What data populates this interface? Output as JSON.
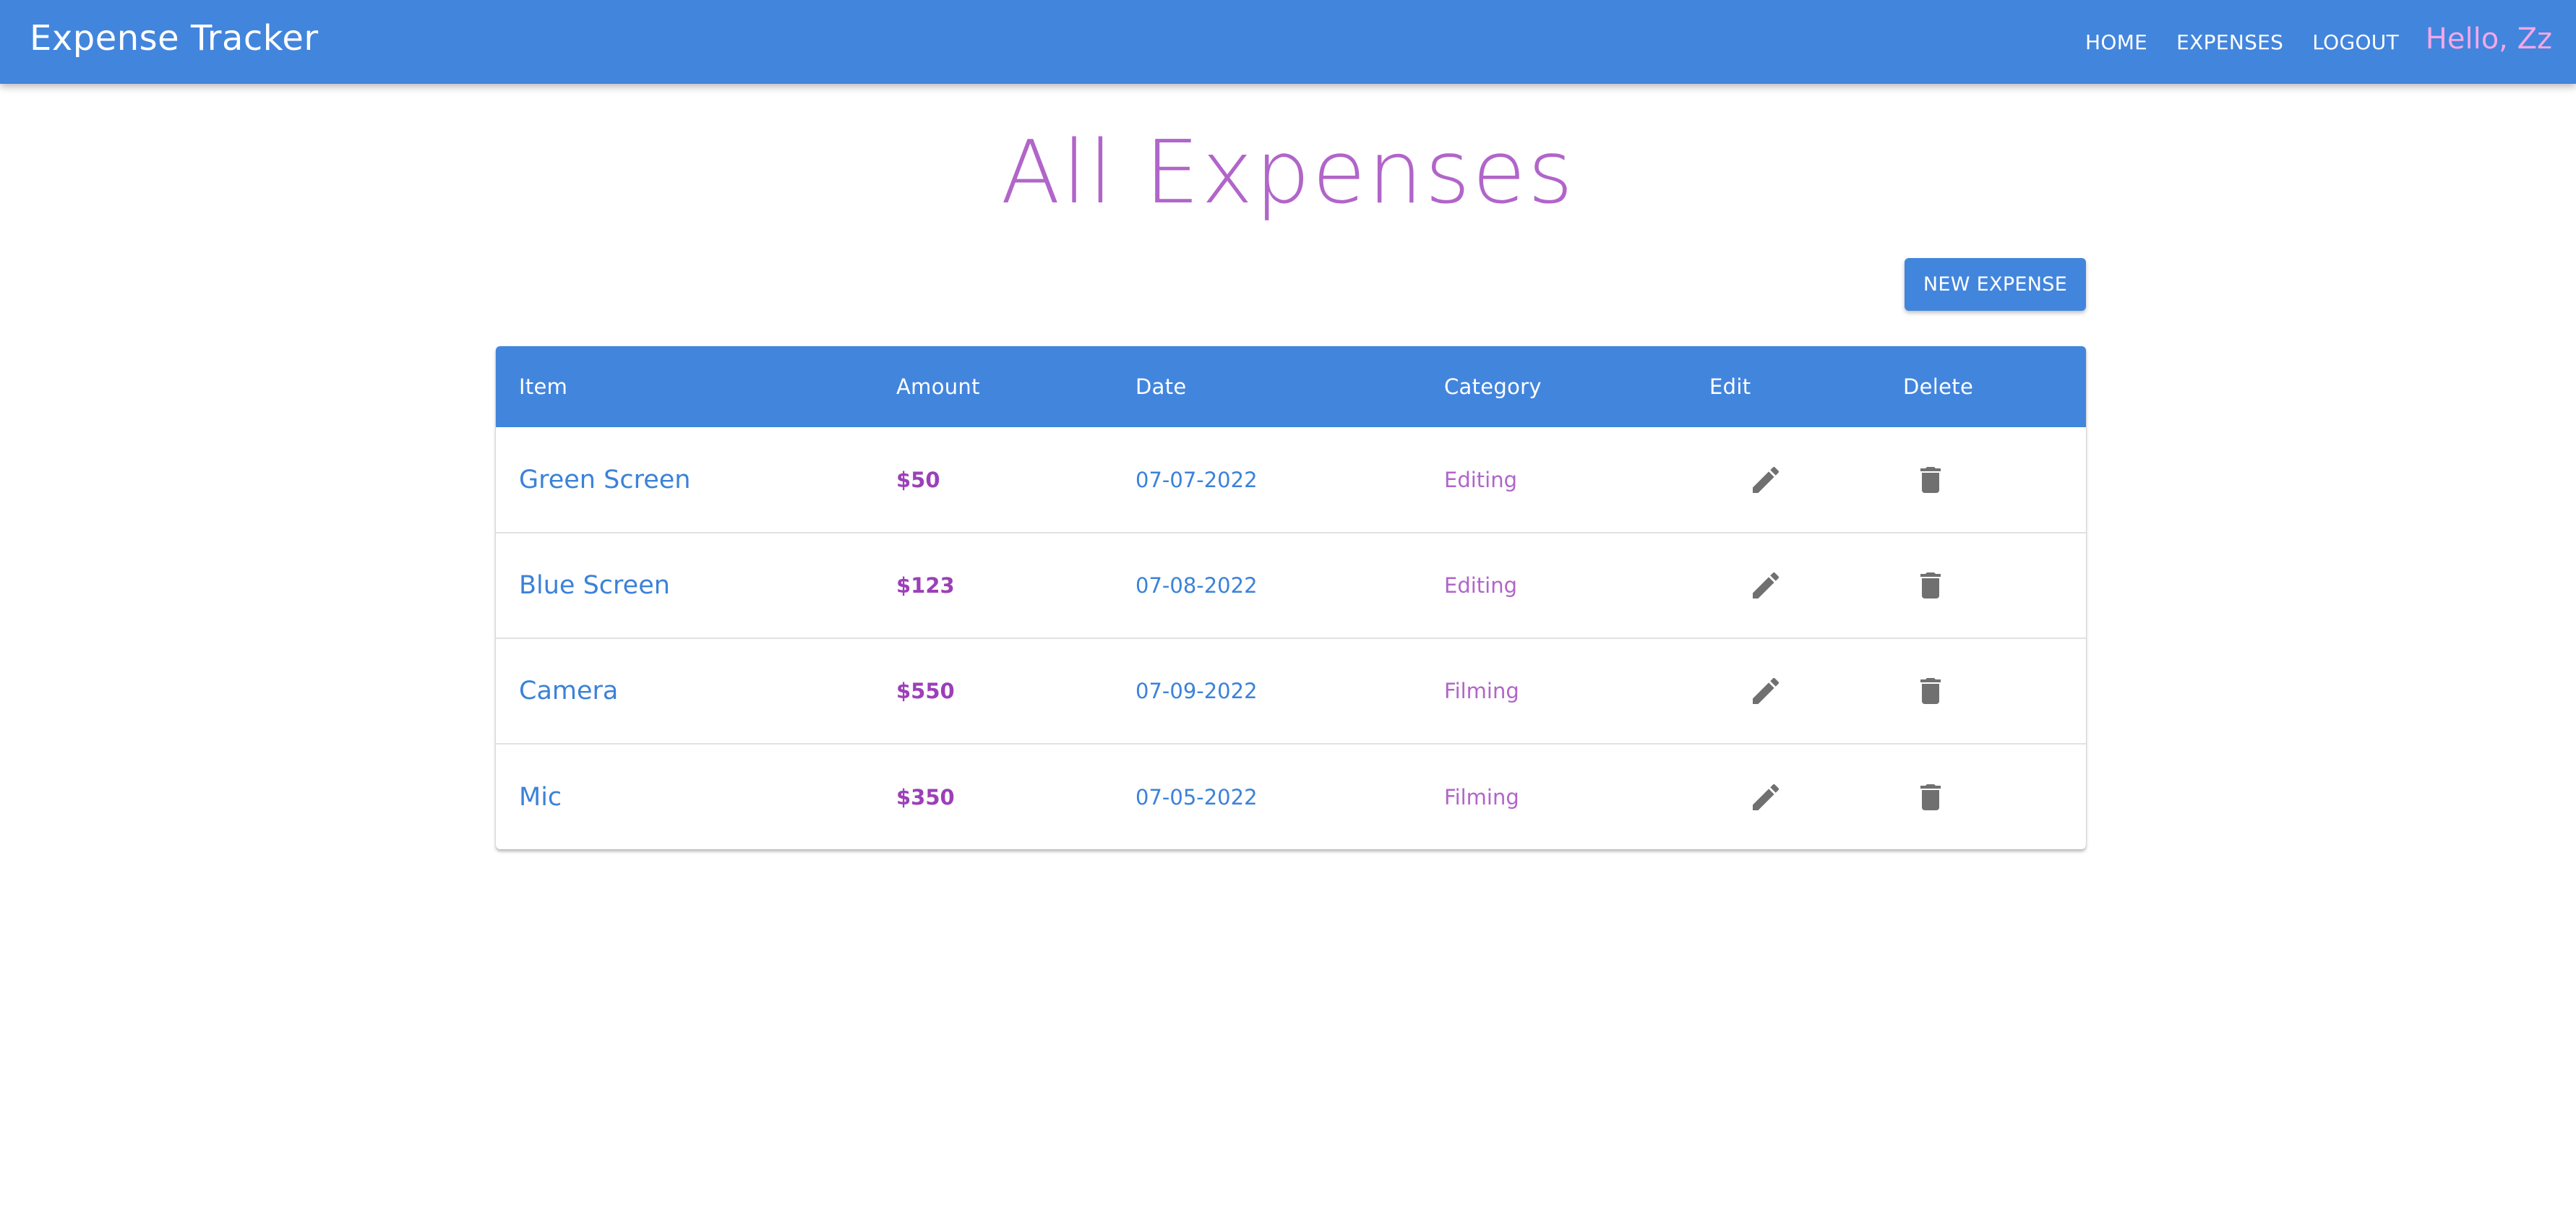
{
  "navbar": {
    "brand": "Expense Tracker",
    "links": [
      {
        "label": "HOME"
      },
      {
        "label": "EXPENSES"
      },
      {
        "label": "LOGOUT"
      }
    ],
    "greeting": "Hello, Zz"
  },
  "page": {
    "title": "All Expenses",
    "new_button_label": "NEW EXPENSE"
  },
  "table": {
    "headers": {
      "item": "Item",
      "amount": "Amount",
      "date": "Date",
      "category": "Category",
      "edit": "Edit",
      "delete": "Delete"
    },
    "rows": [
      {
        "item": "Green Screen",
        "amount": "$50",
        "date": "07-07-2022",
        "category": "Editing",
        "edit_icon": "pencil-icon",
        "delete_icon": "trash-icon"
      },
      {
        "item": "Blue Screen",
        "amount": "$123",
        "date": "07-08-2022",
        "category": "Editing",
        "edit_icon": "pencil-icon",
        "delete_icon": "trash-icon"
      },
      {
        "item": "Camera",
        "amount": "$550",
        "date": "07-09-2022",
        "category": "Filming",
        "edit_icon": "pencil-icon",
        "delete_icon": "trash-icon"
      },
      {
        "item": "Mic",
        "amount": "$350",
        "date": "07-05-2022",
        "category": "Filming",
        "edit_icon": "pencil-icon",
        "delete_icon": "trash-icon"
      }
    ]
  },
  "colors": {
    "primary": "#4285dd",
    "title": "#b165c9",
    "greeting": "#f3a7e7",
    "amount": "#9c3fb8",
    "icon": "#707070"
  }
}
